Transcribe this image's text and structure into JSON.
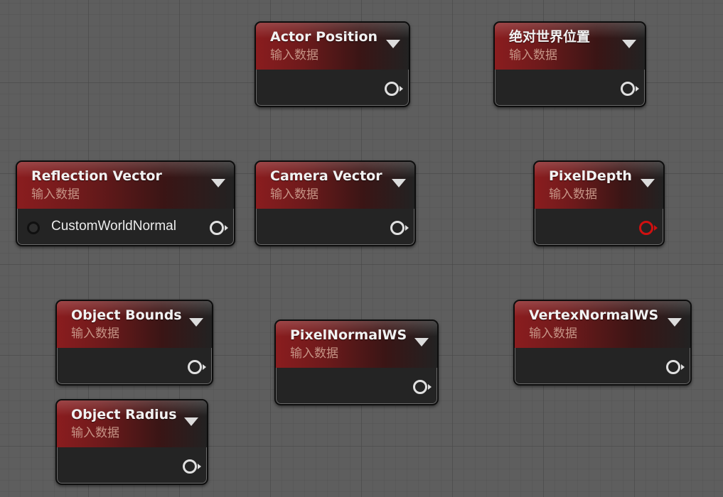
{
  "nodes": [
    {
      "id": "actor-position",
      "title": "Actor Position",
      "subtitle": "输入数据"
    },
    {
      "id": "absolute-world-position",
      "title": "绝对世界位置",
      "subtitle": "输入数据"
    },
    {
      "id": "reflection-vector",
      "title": "Reflection Vector",
      "subtitle": "输入数据",
      "input_pin": "CustomWorldNormal"
    },
    {
      "id": "camera-vector",
      "title": "Camera Vector",
      "subtitle": "输入数据"
    },
    {
      "id": "pixel-depth",
      "title": "PixelDepth",
      "subtitle": "输入数据",
      "output_color": "#d01010"
    },
    {
      "id": "object-bounds",
      "title": "Object Bounds",
      "subtitle": "输入数据"
    },
    {
      "id": "pixel-normal-ws",
      "title": "PixelNormalWS",
      "subtitle": "输入数据"
    },
    {
      "id": "vertex-normal-ws",
      "title": "VertexNormalWS",
      "subtitle": "输入数据"
    },
    {
      "id": "object-radius",
      "title": "Object Radius",
      "subtitle": "输入数据"
    }
  ],
  "colors": {
    "graph_background": "#5e5e5e",
    "header_red": "#8a1d1f",
    "node_body": "#242424",
    "subtitle_text": "#c69486",
    "pin_white": "#e0e0e0",
    "pin_red": "#d01010"
  }
}
